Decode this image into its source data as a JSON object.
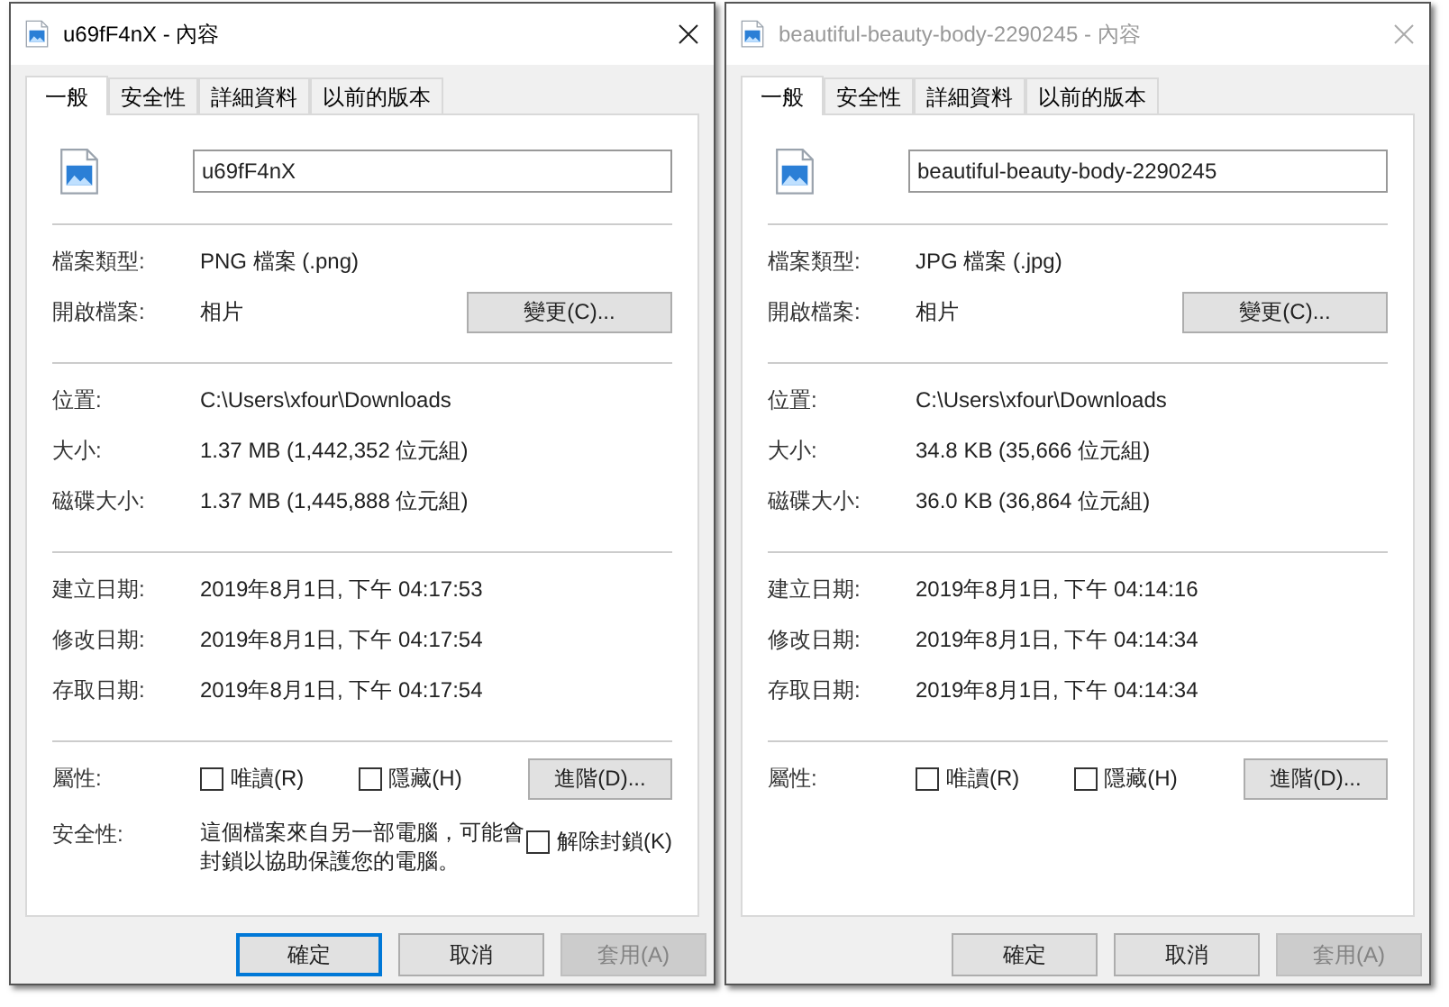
{
  "dialogs": [
    {
      "title": "u69fF4nX - 內容",
      "active": true,
      "tabs": [
        {
          "label": "一般",
          "selected": true
        },
        {
          "label": "安全性",
          "selected": false
        },
        {
          "label": "詳細資料",
          "selected": false
        },
        {
          "label": "以前的版本",
          "selected": false
        }
      ],
      "file_name": "u69fF4nX",
      "sections": [
        [
          {
            "label": "檔案類型:",
            "value": "PNG 檔案 (.png)"
          },
          {
            "label": "開啟檔案:",
            "value": "相片",
            "button": "變更(C)..."
          }
        ],
        [
          {
            "label": "位置:",
            "value": "C:\\Users\\xfour\\Downloads"
          },
          {
            "label": "大小:",
            "value": "1.37 MB (1,442,352 位元組)"
          },
          {
            "label": "磁碟大小:",
            "value": "1.37 MB (1,445,888 位元組)"
          }
        ],
        [
          {
            "label": "建立日期:",
            "value": "2019年8月1日, 下午 04:17:53"
          },
          {
            "label": "修改日期:",
            "value": "2019年8月1日, 下午 04:17:54"
          },
          {
            "label": "存取日期:",
            "value": "2019年8月1日, 下午 04:17:54"
          }
        ]
      ],
      "attributes": {
        "label": "屬性:",
        "checkboxes": [
          {
            "label": "唯讀(R)",
            "checked": false
          },
          {
            "label": "隱藏(H)",
            "checked": false
          }
        ],
        "button": "進階(D)..."
      },
      "security": {
        "label": "安全性:",
        "text": "這個檔案來自另一部電腦，可能會封鎖以協助保護您的電腦。",
        "checkbox": {
          "label": "解除封鎖(K)",
          "checked": false
        }
      },
      "buttons": [
        {
          "label": "確定",
          "default": true,
          "disabled": false
        },
        {
          "label": "取消",
          "default": false,
          "disabled": false
        },
        {
          "label": "套用(A)",
          "default": false,
          "disabled": true
        }
      ]
    },
    {
      "title": "beautiful-beauty-body-2290245 - 內容",
      "active": false,
      "tabs": [
        {
          "label": "一般",
          "selected": true
        },
        {
          "label": "安全性",
          "selected": false
        },
        {
          "label": "詳細資料",
          "selected": false
        },
        {
          "label": "以前的版本",
          "selected": false
        }
      ],
      "file_name": "beautiful-beauty-body-2290245",
      "sections": [
        [
          {
            "label": "檔案類型:",
            "value": "JPG 檔案 (.jpg)"
          },
          {
            "label": "開啟檔案:",
            "value": "相片",
            "button": "變更(C)..."
          }
        ],
        [
          {
            "label": "位置:",
            "value": "C:\\Users\\xfour\\Downloads"
          },
          {
            "label": "大小:",
            "value": "34.8 KB (35,666 位元組)"
          },
          {
            "label": "磁碟大小:",
            "value": "36.0 KB (36,864 位元組)"
          }
        ],
        [
          {
            "label": "建立日期:",
            "value": "2019年8月1日, 下午 04:14:16"
          },
          {
            "label": "修改日期:",
            "value": "2019年8月1日, 下午 04:14:34"
          },
          {
            "label": "存取日期:",
            "value": "2019年8月1日, 下午 04:14:34"
          }
        ]
      ],
      "attributes": {
        "label": "屬性:",
        "checkboxes": [
          {
            "label": "唯讀(R)",
            "checked": false
          },
          {
            "label": "隱藏(H)",
            "checked": false
          }
        ],
        "button": "進階(D)..."
      },
      "buttons": [
        {
          "label": "確定",
          "default": false,
          "disabled": false
        },
        {
          "label": "取消",
          "default": false,
          "disabled": false
        },
        {
          "label": "套用(A)",
          "default": false,
          "disabled": true
        }
      ]
    }
  ]
}
